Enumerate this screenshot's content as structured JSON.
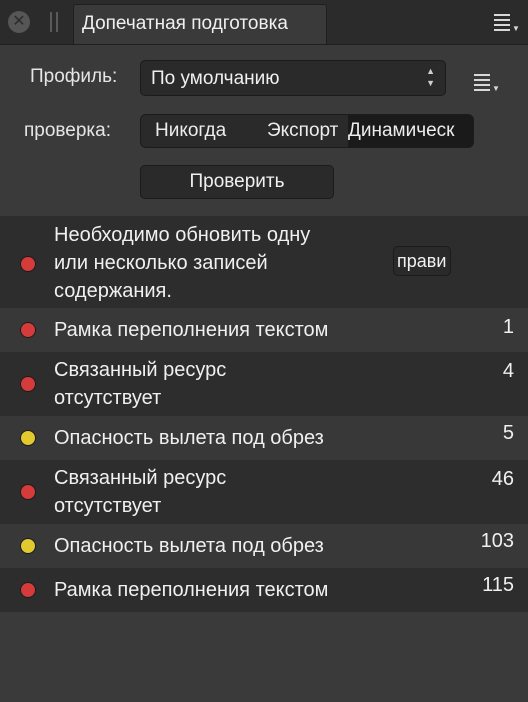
{
  "panel": {
    "tab_title": "Допечатная подготовка",
    "close_glyph": "✕"
  },
  "profile": {
    "label": "Профиль:",
    "value": "По умолчанию",
    "arrow_up": "▲",
    "arrow_down": "▼"
  },
  "check": {
    "label": "проверка:",
    "options": [
      "Никогда",
      "Экспорт",
      "Динамическ"
    ],
    "selected": "Динамическ"
  },
  "actions": {
    "check_button": "Проверить"
  },
  "issues": [
    {
      "text": "Необходимо обновить одну\nили несколько записей\nсодержания.",
      "status": "error",
      "count": "",
      "action": "прави"
    },
    {
      "text": "Рамка переполнения текстом",
      "status": "error",
      "count": "1"
    },
    {
      "text": "Связанный ресурс\nотсутствует",
      "status": "error",
      "count": "4"
    },
    {
      "text": "Опасность вылета под обрез",
      "status": "warning",
      "count": "5"
    },
    {
      "text": "Связанный ресурс\nотсутствует",
      "status": "error",
      "count": "46"
    },
    {
      "text": "Опасность вылета под обрез",
      "status": "warning",
      "count": "103"
    },
    {
      "text": "Рамка переполнения текстом",
      "status": "error",
      "count": "115"
    }
  ],
  "colors": {
    "error": "#d53b3b",
    "warning": "#e2c930",
    "panel_bg": "#3a3a3a"
  },
  "icons": {
    "panel_menu": "hamburger-menu-icon",
    "profile_menu": "hamburger-menu-icon",
    "close": "close-icon",
    "grip": "drag-handle-icon"
  }
}
